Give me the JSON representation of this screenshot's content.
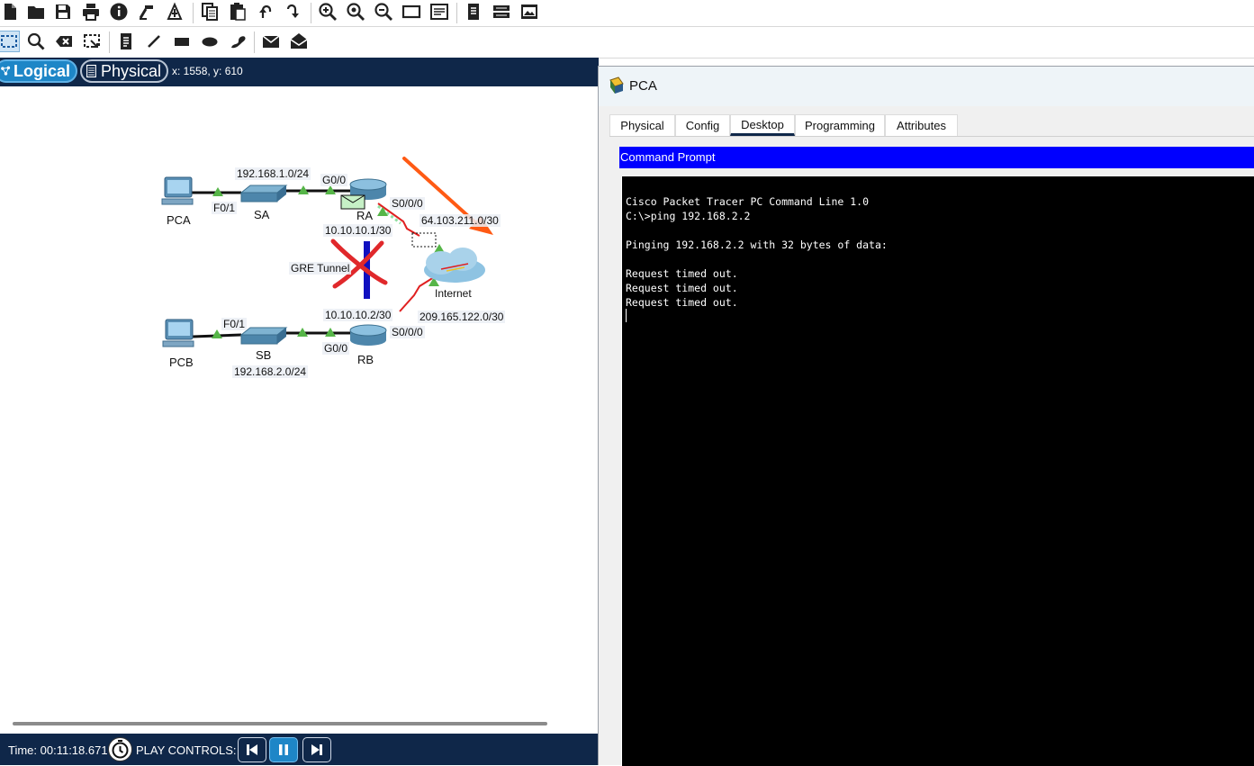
{
  "toolbar": {
    "row1_icons": [
      "new-file-icon",
      "open-folder-icon",
      "save-icon",
      "print-icon",
      "info-icon",
      "wizard-icon",
      "network-info-icon",
      "copy-icon",
      "paste-icon",
      "undo-icon",
      "redo-icon",
      "zoom-in-icon",
      "zoom-reset-icon",
      "zoom-out-icon",
      "drawing-palette-icon",
      "custom-device-icon",
      "notes-icon",
      "device-dialog-icon",
      "screenshot-icon"
    ],
    "row2_icons": [
      "select-icon",
      "inspect-icon",
      "delete-icon",
      "resize-icon",
      "note-icon",
      "line-icon",
      "rectangle-icon",
      "ellipse-icon",
      "freeform-icon",
      "add-pdu-icon",
      "add-complex-pdu-icon"
    ]
  },
  "modebar": {
    "logical_label": "Logical",
    "physical_label": "Physical",
    "coords": "x: 1558, y: 610"
  },
  "topology": {
    "pca_label": "PCA",
    "pcb_label": "PCB",
    "sa_label": "SA",
    "sb_label": "SB",
    "ra_label": "RA",
    "rb_label": "RB",
    "internet_label": "Internet",
    "net_a": "192.168.1.0/24",
    "net_b": "192.168.2.0/24",
    "fa_a": "F0/1",
    "fa_b": "F0/1",
    "g_a": "G0/0",
    "g_b": "G0/0",
    "s_a": "S0/0/0",
    "s_b": "S0/0/0",
    "tunnel_a": "10.10.10.1/30",
    "tunnel_b": "10.10.10.2/30",
    "wan_a": "64.103.211.0/30",
    "wan_b": "209.165.122.0/30",
    "gre_label": "GRE Tunnel"
  },
  "bottombar": {
    "time": "Time: 00:11:18.671",
    "play_controls": "PLAY CONTROLS:"
  },
  "pca_window": {
    "title": "PCA",
    "tabs": [
      "Physical",
      "Config",
      "Desktop",
      "Programming",
      "Attributes"
    ],
    "active_tab": "Desktop",
    "cmd_header": "Command Prompt",
    "cmd_lines": [
      "Cisco Packet Tracer PC Command Line 1.0",
      "C:\\>ping 192.168.2.2",
      "",
      "Pinging 192.168.2.2 with 32 bytes of data:",
      "",
      "Request timed out.",
      "Request timed out.",
      "Request timed out."
    ]
  },
  "colors": {
    "navy": "#0f2749",
    "accent_blue": "#1e86c7",
    "cmd_header_blue": "#0000ff",
    "link_up_green": "#56b548",
    "serial_red": "#e02020",
    "annotation_orange": "#ff5a14",
    "annotation_red_x": "#e0282b",
    "gre_tunnel_blue": "#1010c0"
  }
}
